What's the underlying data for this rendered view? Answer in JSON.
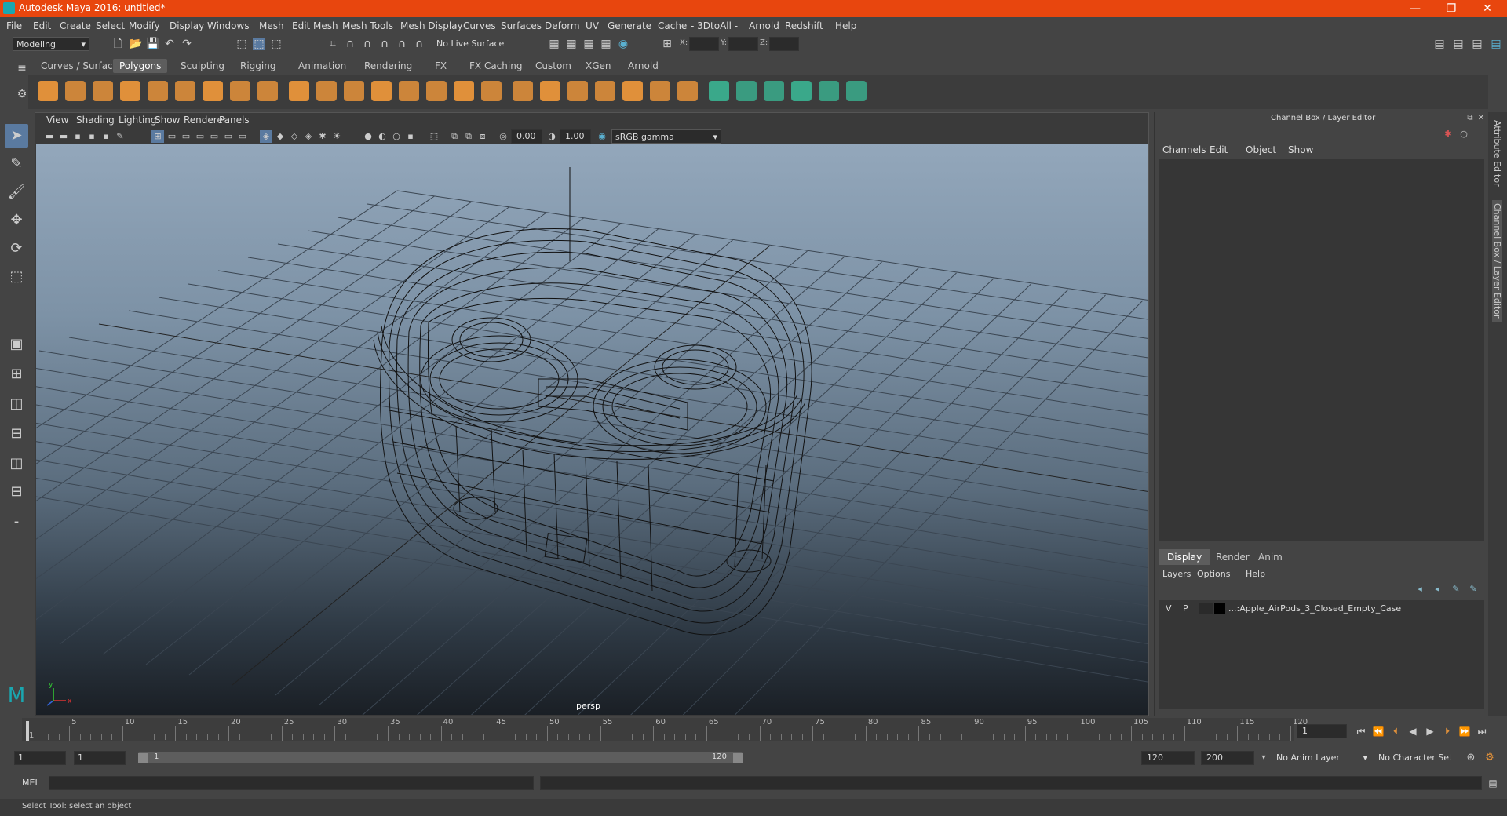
{
  "window": {
    "title": "Autodesk Maya 2016: untitled*",
    "min": "—",
    "max": "❐",
    "close": "✕"
  },
  "menu": [
    "File",
    "Edit",
    "Create",
    "Select",
    "Modify",
    "Display",
    "Windows",
    "Mesh",
    "Edit Mesh",
    "Mesh Tools",
    "Mesh Display",
    "Curves",
    "Surfaces",
    "Deform",
    "UV",
    "Generate",
    "Cache",
    "- 3DtoAll -",
    "Arnold",
    "Redshift",
    "Help"
  ],
  "statusline": {
    "mode": "Modeling",
    "live_surface": "No Live Surface",
    "x_label": "X:",
    "y_label": "Y:",
    "z_label": "Z:"
  },
  "shelf_tabs": [
    "Curves / Surfaces",
    "Polygons",
    "Sculpting",
    "Rigging",
    "Animation",
    "Rendering",
    "FX",
    "FX Caching",
    "Custom",
    "XGen",
    "Arnold"
  ],
  "shelf_active": "Polygons",
  "viewport": {
    "menus": [
      "View",
      "Shading",
      "Lighting",
      "Show",
      "Renderer",
      "Panels"
    ],
    "exposure": "0.00",
    "gamma": "1.00",
    "colorspace": "sRGB gamma",
    "camera": "persp"
  },
  "channelbox": {
    "title": "Channel Box / Layer Editor",
    "menus": [
      "Channels",
      "Edit",
      "Object",
      "Show"
    ],
    "layer_tabs": [
      "Display",
      "Render",
      "Anim"
    ],
    "layer_menus": [
      "Layers",
      "Options",
      "Help"
    ],
    "layer": {
      "v": "V",
      "p": "P",
      "name": "...:Apple_AirPods_3_Closed_Empty_Case"
    }
  },
  "side_tabs": [
    "Attribute Editor",
    "Channel Box / Layer Editor"
  ],
  "timeline": {
    "ticks": [
      "1",
      "5",
      "10",
      "15",
      "20",
      "25",
      "30",
      "35",
      "40",
      "45",
      "50",
      "55",
      "60",
      "65",
      "70",
      "75",
      "80",
      "85",
      "90",
      "95",
      "100",
      "105",
      "110",
      "115",
      "120"
    ],
    "current_frame": "1"
  },
  "range": {
    "start": "1",
    "playback_start": "1",
    "slider_start": "1",
    "slider_end": "120",
    "playback_end": "120",
    "end": "200",
    "anim_layer": "No Anim Layer",
    "char_set": "No Character Set"
  },
  "cmdline": {
    "label": "MEL"
  },
  "help": {
    "text": "Select Tool: select an object"
  },
  "colors": {
    "titlebar": "#e8460e",
    "accent": "#5a7aa0",
    "shelf_icon": "#e0903a"
  }
}
